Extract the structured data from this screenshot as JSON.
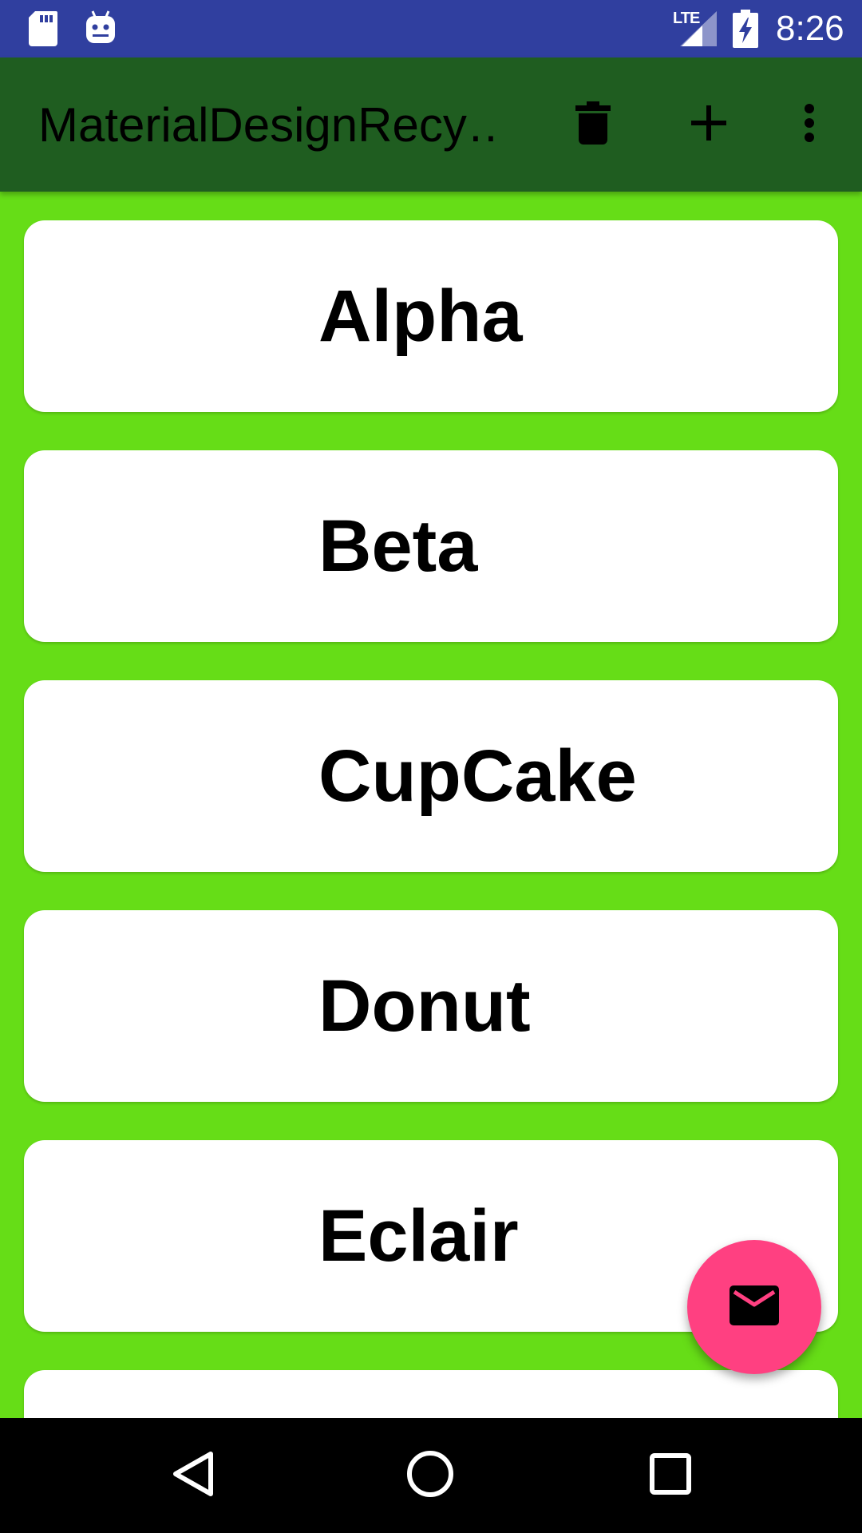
{
  "status_bar": {
    "time": "8:26",
    "network": "LTE",
    "icons": [
      "sd-card-icon",
      "android-debug-icon",
      "signal-icon",
      "battery-charging-icon"
    ],
    "color": "#303F9F"
  },
  "app_bar": {
    "title": "MaterialDesignRecy…",
    "color": "#1F5D20",
    "actions": [
      "delete-icon",
      "add-icon",
      "overflow-menu-icon"
    ]
  },
  "list": {
    "background": "#66DD17",
    "items": [
      {
        "label": "Alpha"
      },
      {
        "label": "Beta"
      },
      {
        "label": "CupCake"
      },
      {
        "label": "Donut"
      },
      {
        "label": "Eclair"
      },
      {
        "label": ""
      }
    ]
  },
  "fab": {
    "icon": "mail-icon",
    "color": "#FF4081"
  },
  "nav_bar": {
    "buttons": [
      "back-icon",
      "home-icon",
      "recents-icon"
    ]
  }
}
